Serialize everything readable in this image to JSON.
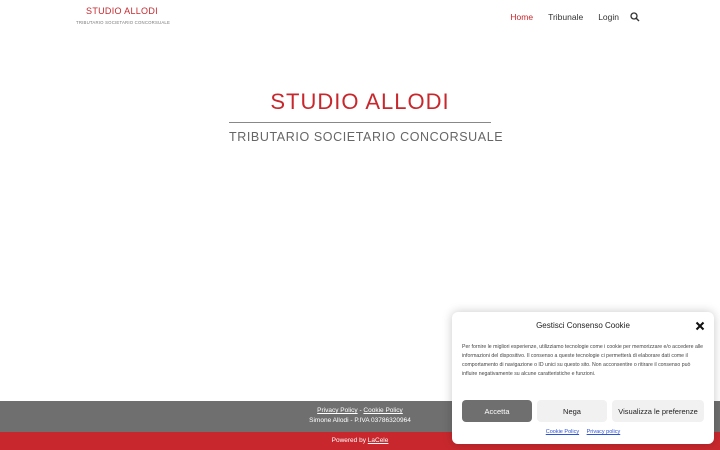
{
  "header": {
    "logo_title": "STUDIO ALLODI",
    "logo_subtitle": "TRIBUTARIO SOCIETARIO CONCORSUALE",
    "nav": [
      {
        "label": "Home",
        "active": true
      },
      {
        "label": "Tribunale",
        "active": false
      },
      {
        "label": "Login",
        "active": false
      }
    ],
    "search_icon": "search-icon"
  },
  "hero": {
    "title": "STUDIO ALLODI",
    "subtitle": "TRIBUTARIO SOCIETARIO CONCORSUALE"
  },
  "footer": {
    "privacy_link": "Privacy Policy",
    "separator": " - ",
    "cookie_link": "Cookie Policy",
    "owner": "Simone Allodi - P.IVA 03786320964",
    "powered_prefix": "Powered by ",
    "powered_link": "LaCele"
  },
  "cookie_banner": {
    "title": "Gestisci Consenso Cookie",
    "body": "Per fornire le migliori esperienze, utilizziamo tecnologie come i cookie per memorizzare e/o accedere alle informazioni del dispositivo. Il consenso a queste tecnologie ci permetterà di elaborare dati come il comportamento di navigazione o ID unici su questo sito. Non acconsentire o ritirare il consenso può influire negativamente su alcune caratteristiche e funzioni.",
    "accept_label": "Accetta",
    "deny_label": "Nega",
    "prefs_label": "Visualizza le preferenze",
    "cookie_policy_link": "Cookie Policy",
    "privacy_policy_link": "Privacy policy"
  },
  "colors": {
    "brand_red": "#c8282d",
    "footer_gray": "#6f6f6f",
    "link_blue": "#2a51d8"
  }
}
